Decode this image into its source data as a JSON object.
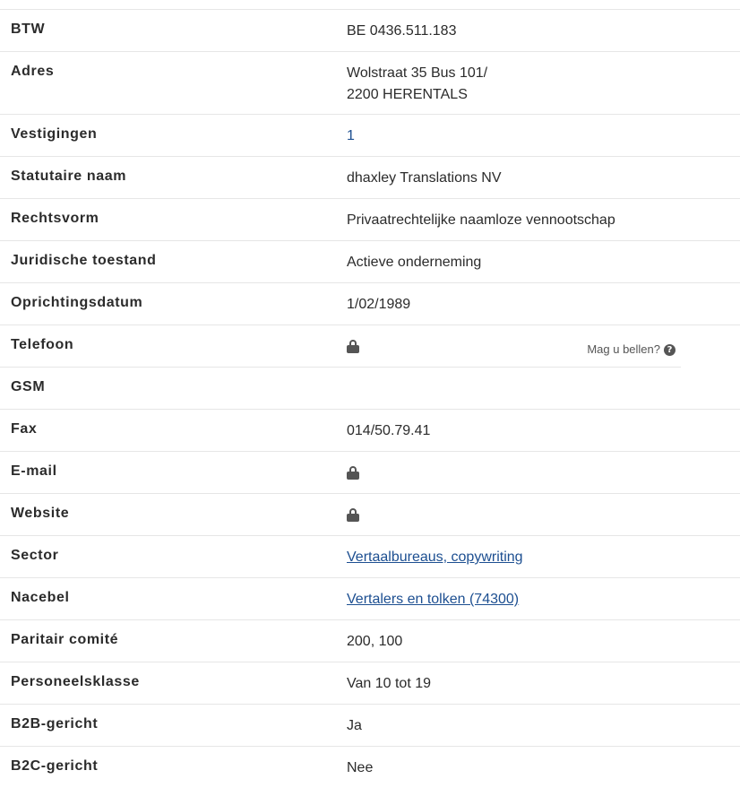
{
  "rows": [
    {
      "label": "BTW",
      "value": "BE 0436.511.183"
    },
    {
      "label": "Adres",
      "value_lines": [
        "Wolstraat 35 Bus 101/",
        "2200 HERENTALS"
      ]
    },
    {
      "label": "Vestigingen",
      "value": "1"
    },
    {
      "label": "Statutaire naam",
      "value": "dhaxley Translations NV"
    },
    {
      "label": "Rechtsvorm",
      "value": "Privaatrechtelijke naamloze vennootschap"
    },
    {
      "label": "Juridische toestand",
      "value": "Actieve onderneming"
    },
    {
      "label": "Oprichtingsdatum",
      "value": "1/02/1989"
    },
    {
      "label": "Telefoon",
      "icon": "lock-icon",
      "hint": "Mag u bellen?",
      "hint_icon": "help-icon"
    },
    {
      "label": "GSM",
      "value": ""
    },
    {
      "label": "Fax",
      "value": "014/50.79.41"
    },
    {
      "label": "E-mail",
      "icon": "lock-icon"
    },
    {
      "label": "Website",
      "icon": "lock-icon"
    },
    {
      "label": "Sector",
      "value": "Vertaalbureaus, copywriting"
    },
    {
      "label": "Nacebel",
      "value": "Vertalers en tolken (74300)"
    },
    {
      "label": "Paritair comité",
      "value": "200, 100"
    },
    {
      "label": "Personeelsklasse",
      "value": "Van 10 tot 19"
    },
    {
      "label": "B2B-gericht",
      "value": "Ja"
    },
    {
      "label": "B2C-gericht",
      "value": "Nee"
    }
  ],
  "colors": {
    "link": "#1d4f91",
    "text": "#2b2b2b",
    "divider": "#e6e6e6",
    "icon": "#555555"
  }
}
